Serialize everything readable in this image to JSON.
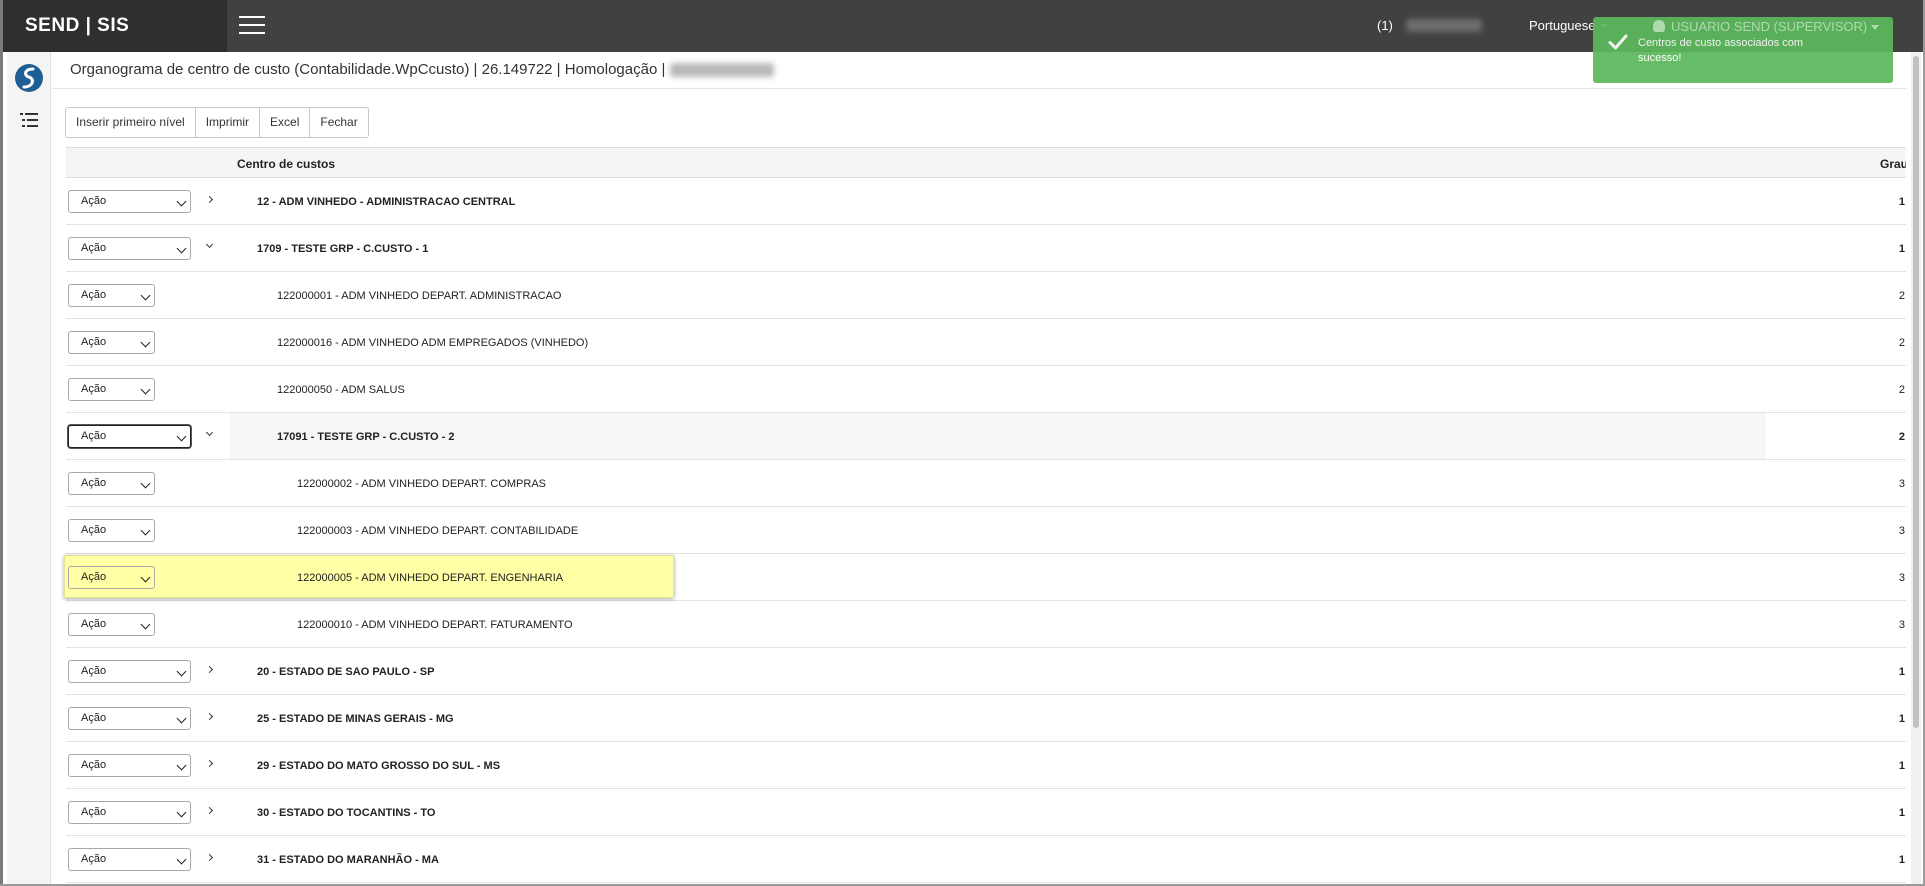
{
  "app": {
    "brand": "SEND | SIS",
    "notifications_badge": "(1)",
    "language": "Portuguese",
    "user": "USUARIO SEND (SUPERVISOR)"
  },
  "toast": {
    "message": "Centros de custo associados com sucesso!"
  },
  "page": {
    "title": "Organograma de centro de custo (Contabilidade.WpCcusto) | 26.149722 | Homologação |"
  },
  "toolbar": {
    "insert_label": "Inserir primeiro nível",
    "print_label": "Imprimir",
    "excel_label": "Excel",
    "close_label": "Fechar"
  },
  "grid": {
    "col_name": "Centro de custos",
    "col_grau": "Grau",
    "rows": [
      {
        "action": "Ação",
        "name": "12 - ADM VINHEDO - ADMINISTRACAO CENTRAL",
        "grau": "1"
      },
      {
        "action": "Ação",
        "name": "1709 - TESTE GRP - C.CUSTO - 1",
        "grau": "1"
      },
      {
        "action": "Ação",
        "name": "122000001 - ADM VINHEDO DEPART. ADMINISTRACAO",
        "grau": "2"
      },
      {
        "action": "Ação",
        "name": "122000016 - ADM VINHEDO ADM EMPREGADOS (VINHEDO)",
        "grau": "2"
      },
      {
        "action": "Ação",
        "name": "122000050 - ADM SALUS",
        "grau": "2"
      },
      {
        "action": "Ação",
        "name": "17091 - TESTE GRP - C.CUSTO - 2",
        "grau": "2"
      },
      {
        "action": "Ação",
        "name": "122000002 - ADM VINHEDO DEPART. COMPRAS",
        "grau": "3"
      },
      {
        "action": "Ação",
        "name": "122000003 - ADM VINHEDO DEPART. CONTABILIDADE",
        "grau": "3"
      },
      {
        "action": "Ação",
        "name": "122000005 - ADM VINHEDO DEPART. ENGENHARIA",
        "grau": "3"
      },
      {
        "action": "Ação",
        "name": "122000010 - ADM VINHEDO DEPART. FATURAMENTO",
        "grau": "3"
      },
      {
        "action": "Ação",
        "name": "20 - ESTADO DE SAO PAULO - SP",
        "grau": "1"
      },
      {
        "action": "Ação",
        "name": "25 - ESTADO DE MINAS GERAIS - MG",
        "grau": "1"
      },
      {
        "action": "Ação",
        "name": "29 - ESTADO DO MATO GROSSO DO SUL - MS",
        "grau": "1"
      },
      {
        "action": "Ação",
        "name": "30 - ESTADO DO TOCANTINS - TO",
        "grau": "1"
      },
      {
        "action": "Ação",
        "name": "31 - ESTADO DO MARANHÃO - MA",
        "grau": "1"
      }
    ]
  },
  "icons": {
    "toast": "check-icon",
    "sidebar_logo": "logo-icon",
    "sidebar_tree": "tree-list-icon",
    "menu": "hamburger-icon"
  },
  "colors": {
    "topbar": "#414141",
    "toast": "#5cb85c",
    "highlight": "#ffffa5"
  }
}
